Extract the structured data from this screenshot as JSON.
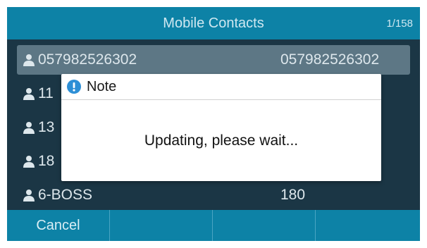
{
  "header": {
    "title": "Mobile Contacts",
    "counter": "1/158"
  },
  "contacts": [
    {
      "name": "057982526302",
      "number": "057982526302",
      "selected": true
    },
    {
      "name": "11",
      "number": ""
    },
    {
      "name": "13",
      "number": ""
    },
    {
      "name": "18",
      "number": ""
    },
    {
      "name": "6-BOSS",
      "number": "180"
    }
  ],
  "dialog": {
    "title": "Note",
    "message": "Updating, please wait..."
  },
  "softkeys": [
    "Cancel",
    "",
    "",
    ""
  ],
  "colors": {
    "title_bar": "#0d82a6",
    "background": "#1b3645",
    "selected_row": "#5d7785",
    "info_icon": "#2d8fd6"
  },
  "icons": {
    "contact": "person-icon",
    "dialog": "info-icon"
  }
}
